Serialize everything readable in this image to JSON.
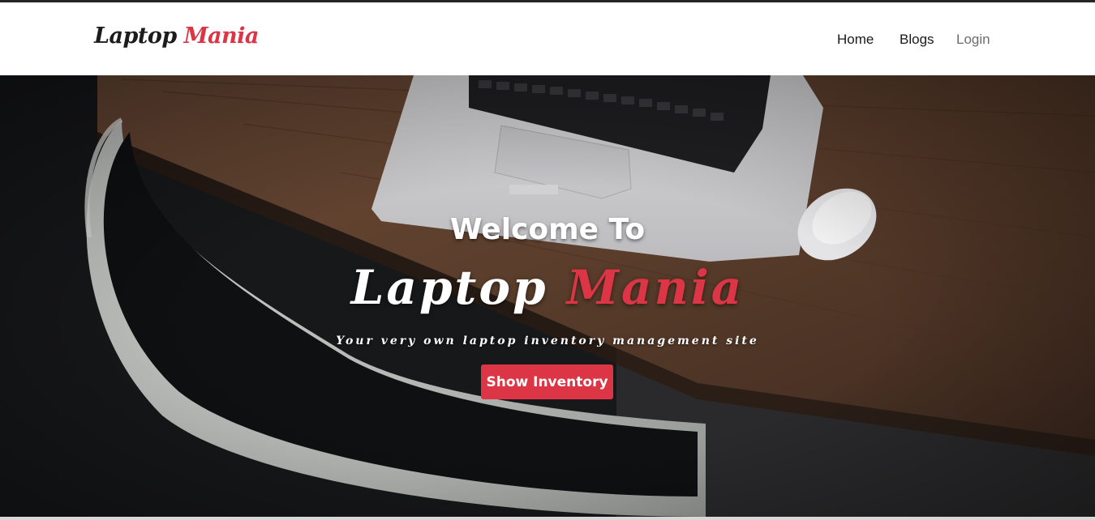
{
  "navbar": {
    "brand_part1": "Laptop",
    "brand_part2": "Mania",
    "links": [
      {
        "label": "Home"
      },
      {
        "label": "Blogs"
      },
      {
        "label": "Login"
      }
    ]
  },
  "hero": {
    "welcome": "Welcome To",
    "title_part1": "Laptop",
    "title_part2": "Mania",
    "tagline": "Your very own laptop inventory management site",
    "cta_label": "Show Inventory",
    "background": "laptop-desk-chair-photo"
  },
  "colors": {
    "accent": "#dc3545",
    "nav_text": "#1a1a1a",
    "nav_muted": "#6c6c6c"
  }
}
